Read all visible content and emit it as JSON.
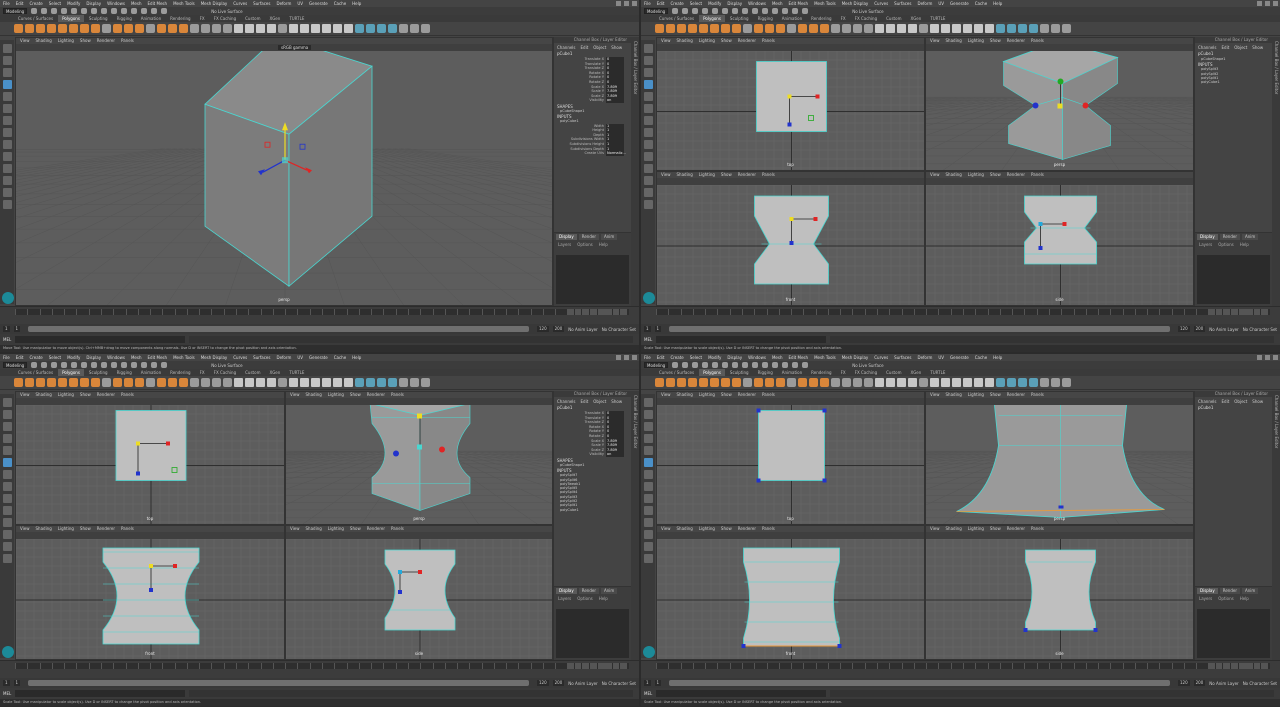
{
  "menus": [
    "File",
    "Edit",
    "Create",
    "Select",
    "Modify",
    "Display",
    "Windows",
    "Mesh",
    "Edit Mesh",
    "Mesh Tools",
    "Mesh Display",
    "Curves",
    "Surfaces",
    "Deform",
    "UV",
    "Generate",
    "Cache",
    "Help"
  ],
  "mode": "Modeling",
  "live_surface": "No Live Surface",
  "shelf_tabs": [
    "Curves / Surfaces",
    "Polygons",
    "Sculpting",
    "Rigging",
    "Animation",
    "Rendering",
    "FX",
    "FX Caching",
    "Custom",
    "XGen",
    "TURTLE"
  ],
  "pane_menu": [
    "View",
    "Shading",
    "Lighting",
    "Show",
    "Renderer",
    "Panels"
  ],
  "gamma": "sRGB gamma",
  "channel_box": {
    "header": "Channel Box / Layer Editor",
    "menu": [
      "Channels",
      "Edit",
      "Object",
      "Show"
    ],
    "object": "pCube1",
    "attributes": [
      {
        "k": "Translate X",
        "v": "0"
      },
      {
        "k": "Translate Y",
        "v": "0"
      },
      {
        "k": "Translate Z",
        "v": "0"
      },
      {
        "k": "Rotate X",
        "v": "0"
      },
      {
        "k": "Rotate Y",
        "v": "0"
      },
      {
        "k": "Rotate Z",
        "v": "0"
      },
      {
        "k": "Scale X",
        "v": "7.809"
      },
      {
        "k": "Scale Y",
        "v": "7.809"
      },
      {
        "k": "Scale Z",
        "v": "7.809"
      },
      {
        "k": "Visibility",
        "v": "on"
      }
    ],
    "shapes_label": "SHAPES",
    "shape": "pCubeShape1",
    "inputs_label": "INPUTS",
    "inputs_q0": [
      "polyCube1"
    ],
    "cube_attrs": [
      {
        "k": "Width",
        "v": "1"
      },
      {
        "k": "Height",
        "v": "1"
      },
      {
        "k": "Depth",
        "v": "1"
      },
      {
        "k": "Subdivisions Width",
        "v": "1"
      },
      {
        "k": "Subdivisions Height",
        "v": "1"
      },
      {
        "k": "Subdivisions Depth",
        "v": "1"
      },
      {
        "k": "Create UVs",
        "v": "Normaliz..."
      }
    ],
    "inputs_q1": [
      "polySplit3",
      "polySplit2",
      "polySplit1",
      "polyCube1"
    ],
    "inputs_q2": [
      "polySplit7",
      "polySplit6",
      "polyTweak1",
      "polySplit5",
      "polySplit4",
      "polySplit3",
      "polySplit2",
      "polySplit1",
      "polyCube1"
    ]
  },
  "layer_tabs": [
    "Display",
    "Render",
    "Anim"
  ],
  "layer_menu": [
    "Layers",
    "Options",
    "Help"
  ],
  "side_tab": "Channel Box / Layer Editor",
  "range": {
    "start": "1",
    "cur": "1",
    "end_a": "120",
    "end_b": "120",
    "end_c": "200",
    "anim_layer": "No Anim Layer",
    "char_set": "No Character Set",
    "slider_label": "120"
  },
  "mel": "MEL",
  "help_texts": [
    "Move Tool: Use manipulator to move object(s). Ctrl+MMB+drag to move components along normals. Use D or INSERT to change the pivot position and axis orientation.",
    "Scale Tool: Use manipulator to scale object(s). Use D or INSERT to change the pivot position and axis orientation.",
    "Scale Tool: Use manipulator to scale object(s). Use D or INSERT to change the pivot position and axis orientation.",
    "Scale Tool: Use manipulator to scale object(s). Use D or INSERT to change the pivot position and axis orientation."
  ],
  "labels": {
    "persp": "persp",
    "top": "top",
    "front": "front",
    "side": "side"
  },
  "colors": {
    "accent": "#4ad7d1",
    "bg": "#5d5d5d",
    "orange": "#d9863a"
  }
}
